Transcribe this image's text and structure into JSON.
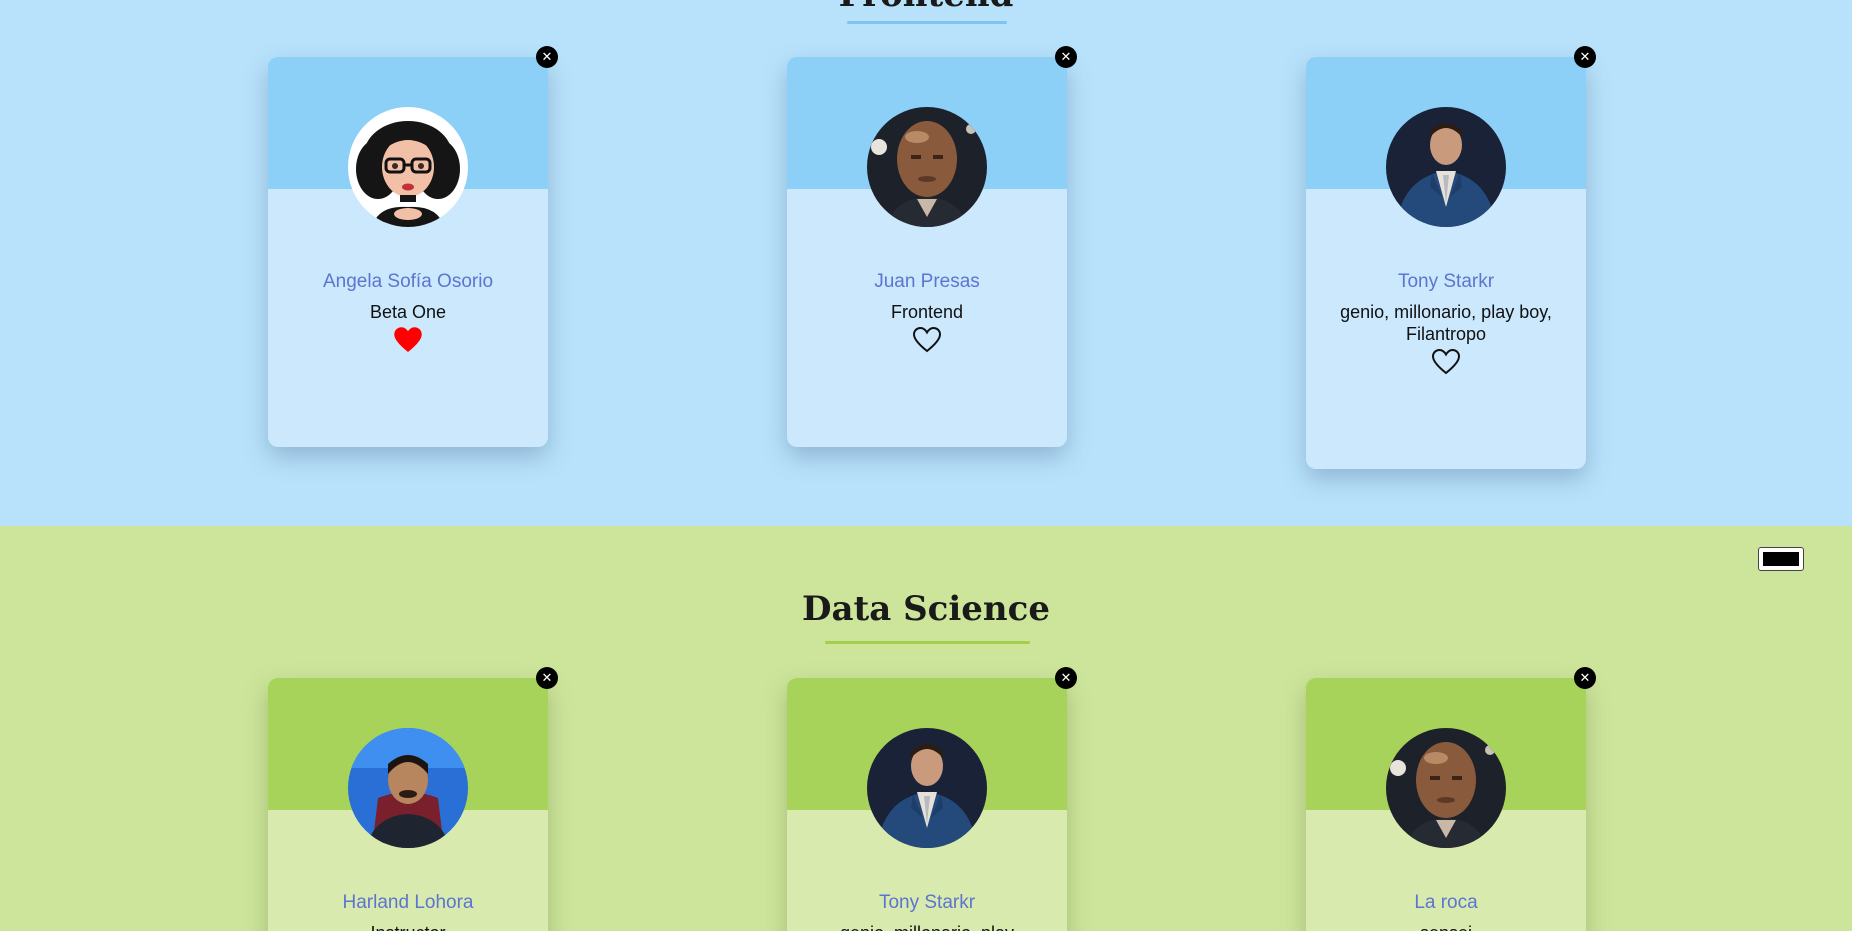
{
  "sections": [
    {
      "title": "Frontend",
      "cards": [
        {
          "name": "Angela Sofía Osorio",
          "role": "Beta One",
          "liked": true,
          "avatar": "cartoon-girl-avatar"
        },
        {
          "name": "Juan Presas",
          "role": "Frontend",
          "liked": false,
          "avatar": "bald-man-avatar"
        },
        {
          "name": "Tony Starkr",
          "role": "genio, millonario, play boy, Filantropo",
          "liked": false,
          "avatar": "man-in-suit-avatar"
        }
      ]
    },
    {
      "title": "Data Science",
      "cards": [
        {
          "name": "Harland Lohora",
          "role": "Instructor",
          "avatar": "man-blue-background-avatar"
        },
        {
          "name": "Tony Starkr",
          "role": "genio, millonario, play",
          "avatar": "man-in-suit-avatar"
        },
        {
          "name": "La roca",
          "role": "sensei",
          "avatar": "bald-man-avatar"
        }
      ]
    }
  ],
  "colors": {
    "frontend_bg": "#b8e2fb",
    "frontend_header": "#8ccff7",
    "data_science_bg": "#cde59b",
    "data_science_header": "#a8d35a",
    "name_color": "#5b75d1",
    "heart_liked": "#ff0000"
  },
  "icons": {
    "close": "close-circle-icon",
    "like": "heart-icon"
  }
}
